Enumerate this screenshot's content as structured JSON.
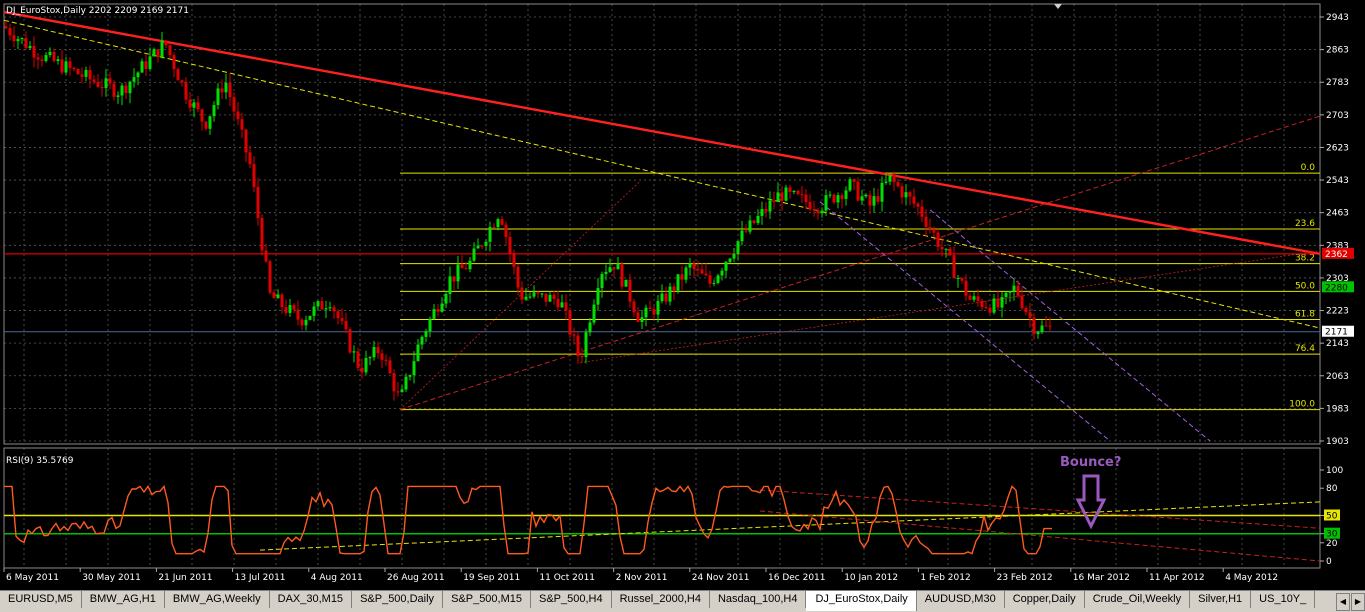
{
  "window": {
    "title": "DJ_EuroStox,Daily  2202 2209 2169 2171",
    "symbol_title": "DJ_EuroStox,Daily",
    "ohlc": "2202 2209 2169 2171"
  },
  "indicator": {
    "title": "RSI(9) 35.5769",
    "value": 35.5769,
    "levels": [
      "100",
      "80",
      "50",
      "30",
      "20",
      "0"
    ],
    "highlighted_levels": [
      "50",
      "30"
    ],
    "annotation": "Bounce?",
    "annotation_color": "#9b59c0"
  },
  "price_axis": {
    "ticks": [
      "2943",
      "2863",
      "2783",
      "2703",
      "2623",
      "2543",
      "2463",
      "2383",
      "2303",
      "2223",
      "2143",
      "2063",
      "1983",
      "1903"
    ],
    "current_price": "2171",
    "marker_2280": "2280",
    "marker_2362": "2362"
  },
  "time_axis": {
    "labels": [
      "6 May 2011",
      "30 May 2011",
      "21 Jun 2011",
      "13 Jul 2011",
      "4 Aug 2011",
      "26 Aug 2011",
      "19 Sep 2011",
      "11 Oct 2011",
      "2 Nov 2011",
      "24 Nov 2011",
      "16 Dec 2011",
      "10 Jan 2012",
      "1 Feb 2012",
      "23 Feb 2012",
      "16 Mar 2012",
      "11 Apr 2012",
      "4 May 2012"
    ]
  },
  "fibonacci": {
    "levels": [
      {
        "label": "0.0",
        "price": 2560
      },
      {
        "label": "23.6",
        "price": 2423
      },
      {
        "label": "38.2",
        "price": 2338
      },
      {
        "label": "50.0",
        "price": 2270
      },
      {
        "label": "61.8",
        "price": 2201
      },
      {
        "label": "76.4",
        "price": 2116
      },
      {
        "label": "100.0",
        "price": 1980
      }
    ],
    "color": "#e6e600"
  },
  "colors": {
    "bull": "#00e000",
    "bear": "#e00000",
    "grid": "#5a5a5a",
    "main_trend": "#ff2020",
    "rsi_line": "#ff5a1e",
    "fib": "#e6e600"
  },
  "tabs": [
    {
      "label": "EURUSD,M5",
      "active": false
    },
    {
      "label": "BMW_AG,H1",
      "active": false
    },
    {
      "label": "BMW_AG,Weekly",
      "active": false
    },
    {
      "label": "DAX_30,M15",
      "active": false
    },
    {
      "label": "S&P_500,Daily",
      "active": false
    },
    {
      "label": "S&P_500,M15",
      "active": false
    },
    {
      "label": "S&P_500,H4",
      "active": false
    },
    {
      "label": "Russel_2000,H4",
      "active": false
    },
    {
      "label": "Nasdaq_100,H4",
      "active": false
    },
    {
      "label": "DJ_EuroStox,Daily",
      "active": true
    },
    {
      "label": "AUDUSD,M30",
      "active": false
    },
    {
      "label": "Copper,Daily",
      "active": false
    },
    {
      "label": "Crude_Oil,Weekly",
      "active": false
    },
    {
      "label": "Silver,H1",
      "active": false
    },
    {
      "label": "US_10Y_",
      "active": false
    }
  ],
  "tab_nav": {
    "prev": "◀",
    "next": "▶"
  }
}
